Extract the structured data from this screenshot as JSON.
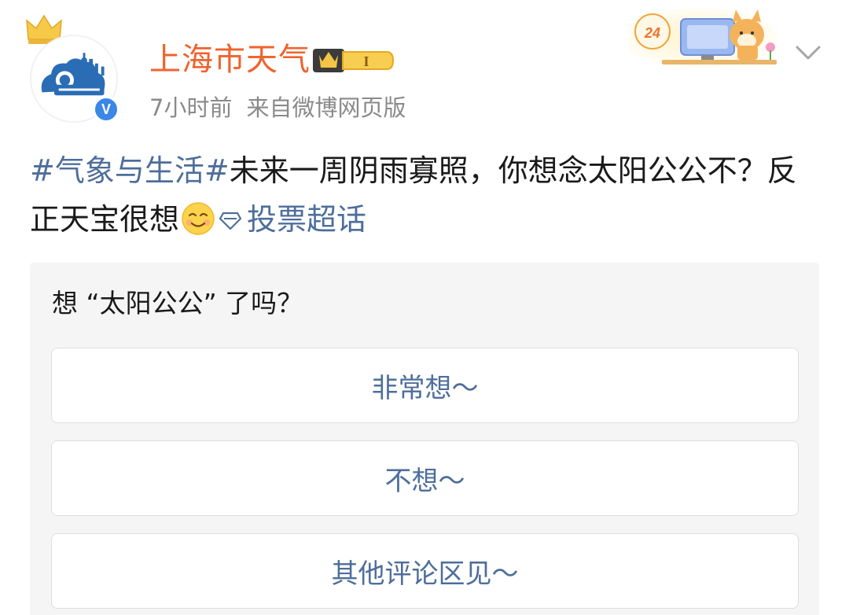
{
  "post": {
    "author": "上海市天气",
    "time": "7小时前",
    "source": "来自微博网页版",
    "hashtag": "#气象与生活#",
    "text": "未来一周阴雨寡照，你想念太阳公公不？反正天宝很想",
    "supertopic_label": "投票超话"
  },
  "badges": {
    "level_text": "I",
    "verified_text": "V"
  },
  "decoration": {
    "badge_number": "24"
  },
  "poll": {
    "question": "想 “太阳公公” 了吗？",
    "options": [
      "非常想～",
      "不想～",
      "其他评论区见～"
    ]
  },
  "icons": {
    "crown": "crown-icon",
    "verified": "verified-badge-icon",
    "vip": "vip-level-badge-icon",
    "emoji": "smile-emoji-icon",
    "supertopic": "diamond-supertopic-icon",
    "menu": "chevron-down-icon"
  },
  "colors": {
    "username": "#f0632c",
    "link": "#4e6e9b",
    "meta": "#8a8a8a",
    "poll_bg": "#f5f5f5",
    "verified": "#3a87e8"
  }
}
